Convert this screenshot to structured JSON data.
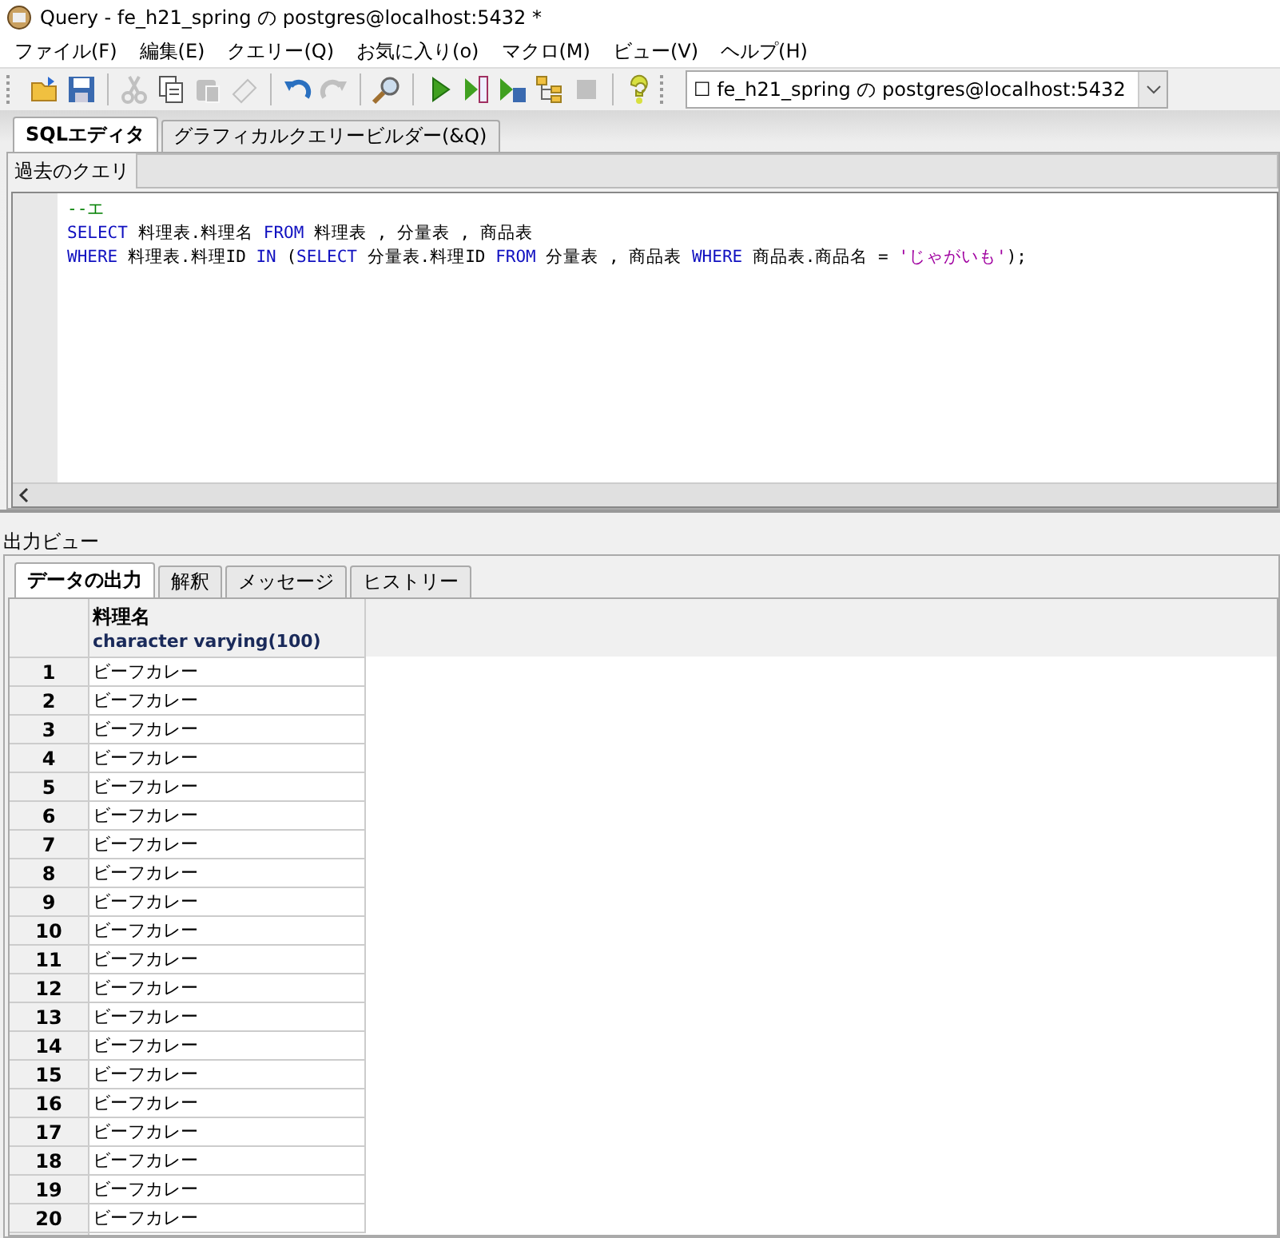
{
  "window": {
    "title": "Query - fe_h21_spring の postgres@localhost:5432 *"
  },
  "menu": [
    "ファイル(F)",
    "編集(E)",
    "クエリー(Q)",
    "お気に入り(o)",
    "マクロ(M)",
    "ビュー(V)",
    "ヘルプ(H)"
  ],
  "toolbar": [
    {
      "kind": "open",
      "disabled": false
    },
    {
      "kind": "save",
      "disabled": false
    },
    {
      "kind": "sep"
    },
    {
      "kind": "cut",
      "disabled": true
    },
    {
      "kind": "copy",
      "disabled": false
    },
    {
      "kind": "paste",
      "disabled": true
    },
    {
      "kind": "clear",
      "disabled": true
    },
    {
      "kind": "sep"
    },
    {
      "kind": "undo",
      "disabled": false
    },
    {
      "kind": "redo",
      "disabled": true
    },
    {
      "kind": "sep"
    },
    {
      "kind": "find",
      "disabled": false
    },
    {
      "kind": "sep"
    },
    {
      "kind": "run",
      "disabled": false
    },
    {
      "kind": "pgscript",
      "disabled": false
    },
    {
      "kind": "runsave",
      "disabled": false
    },
    {
      "kind": "explain",
      "disabled": false
    },
    {
      "kind": "stop",
      "disabled": true
    },
    {
      "kind": "sep"
    },
    {
      "kind": "help",
      "disabled": false
    }
  ],
  "connection": {
    "value": "☐ fe_h21_spring の postgres@localhost:5432"
  },
  "editor_tabs": [
    {
      "label": "SQLエディタ",
      "selected": true
    },
    {
      "label": "グラフィカルクエリービルダー(&Q)",
      "selected": false
    }
  ],
  "history": {
    "label": "過去のクエリ"
  },
  "editor": {
    "lines": [
      [
        {
          "kind": "comment",
          "text": "--エ"
        }
      ],
      [
        {
          "kind": "keyword",
          "text": "SELECT"
        },
        {
          "kind": "plain",
          "text": " 料理表.料理名 "
        },
        {
          "kind": "keyword",
          "text": "FROM"
        },
        {
          "kind": "plain",
          "text": " 料理表 , 分量表 , 商品表"
        }
      ],
      [
        {
          "kind": "keyword",
          "text": "WHERE"
        },
        {
          "kind": "plain",
          "text": " 料理表.料理ID "
        },
        {
          "kind": "keyword",
          "text": "IN"
        },
        {
          "kind": "plain",
          "text": " ("
        },
        {
          "kind": "keyword",
          "text": "SELECT"
        },
        {
          "kind": "plain",
          "text": " 分量表.料理ID "
        },
        {
          "kind": "keyword",
          "text": "FROM"
        },
        {
          "kind": "plain",
          "text": " 分量表 , 商品表 "
        },
        {
          "kind": "keyword",
          "text": "WHERE"
        },
        {
          "kind": "plain",
          "text": " 商品表.商品名 = "
        },
        {
          "kind": "string",
          "text": "'じゃがいも'"
        },
        {
          "kind": "plain",
          "text": ");"
        }
      ]
    ]
  },
  "output": {
    "title": "出力ビュー",
    "tabs": [
      {
        "label": "データの出力",
        "selected": true
      },
      {
        "label": "解釈",
        "selected": false
      },
      {
        "label": "メッセージ",
        "selected": false
      },
      {
        "label": "ヒストリー",
        "selected": false
      }
    ],
    "table": {
      "column": {
        "name": "料理名",
        "type": "character varying(100)"
      },
      "rows": [
        {
          "number": "1",
          "value": "ビーフカレー"
        },
        {
          "number": "2",
          "value": "ビーフカレー"
        },
        {
          "number": "3",
          "value": "ビーフカレー"
        },
        {
          "number": "4",
          "value": "ビーフカレー"
        },
        {
          "number": "5",
          "value": "ビーフカレー"
        },
        {
          "number": "6",
          "value": "ビーフカレー"
        },
        {
          "number": "7",
          "value": "ビーフカレー"
        },
        {
          "number": "8",
          "value": "ビーフカレー"
        },
        {
          "number": "9",
          "value": "ビーフカレー"
        },
        {
          "number": "10",
          "value": "ビーフカレー"
        },
        {
          "number": "11",
          "value": "ビーフカレー"
        },
        {
          "number": "12",
          "value": "ビーフカレー"
        },
        {
          "number": "13",
          "value": "ビーフカレー"
        },
        {
          "number": "14",
          "value": "ビーフカレー"
        },
        {
          "number": "15",
          "value": "ビーフカレー"
        },
        {
          "number": "16",
          "value": "ビーフカレー"
        },
        {
          "number": "17",
          "value": "ビーフカレー"
        },
        {
          "number": "18",
          "value": "ビーフカレー"
        },
        {
          "number": "19",
          "value": "ビーフカレー"
        },
        {
          "number": "20",
          "value": "ビーフカレー"
        }
      ]
    }
  }
}
